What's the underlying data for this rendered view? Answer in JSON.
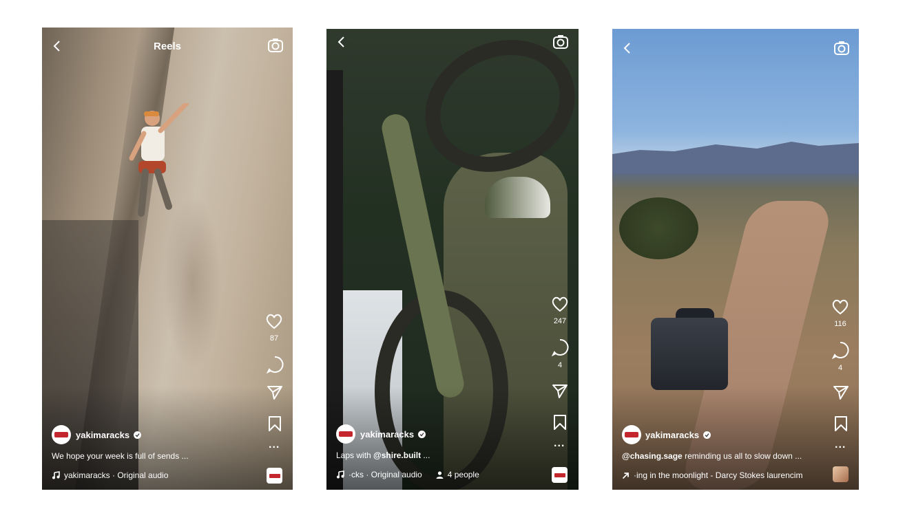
{
  "reels": [
    {
      "title": "Reels",
      "likes": "87",
      "username": "yakimaracks",
      "caption": "We hope your week is full of sends ...",
      "audio": "yakimaracks · Original audio",
      "more": "..."
    },
    {
      "likes": "247",
      "comments": "4",
      "username": "yakimaracks",
      "caption_prefix": "Laps with ",
      "caption_mention": "@shire.built",
      "caption_suffix": " ...",
      "audio": "·cks · Original audio",
      "people": "4 people",
      "more": "..."
    },
    {
      "likes": "116",
      "comments": "4",
      "username": "yakimaracks",
      "caption_mention": "@chasing.sage",
      "caption_suffix": " reminding us all to slow down ...",
      "audio": "·ing in the moonlight - Darcy Stokes  laurencim",
      "more": "..."
    }
  ],
  "icons": {
    "back": "chevron-left-icon",
    "camera": "camera-icon",
    "like": "heart-icon",
    "comment": "comment-icon",
    "share": "send-icon",
    "save": "bookmark-icon",
    "music": "music-note-icon",
    "people": "person-icon",
    "arrow": "trending-arrow-icon"
  },
  "colors": {
    "brand_red": "#c4262e",
    "overlay_text": "#ffffff"
  }
}
